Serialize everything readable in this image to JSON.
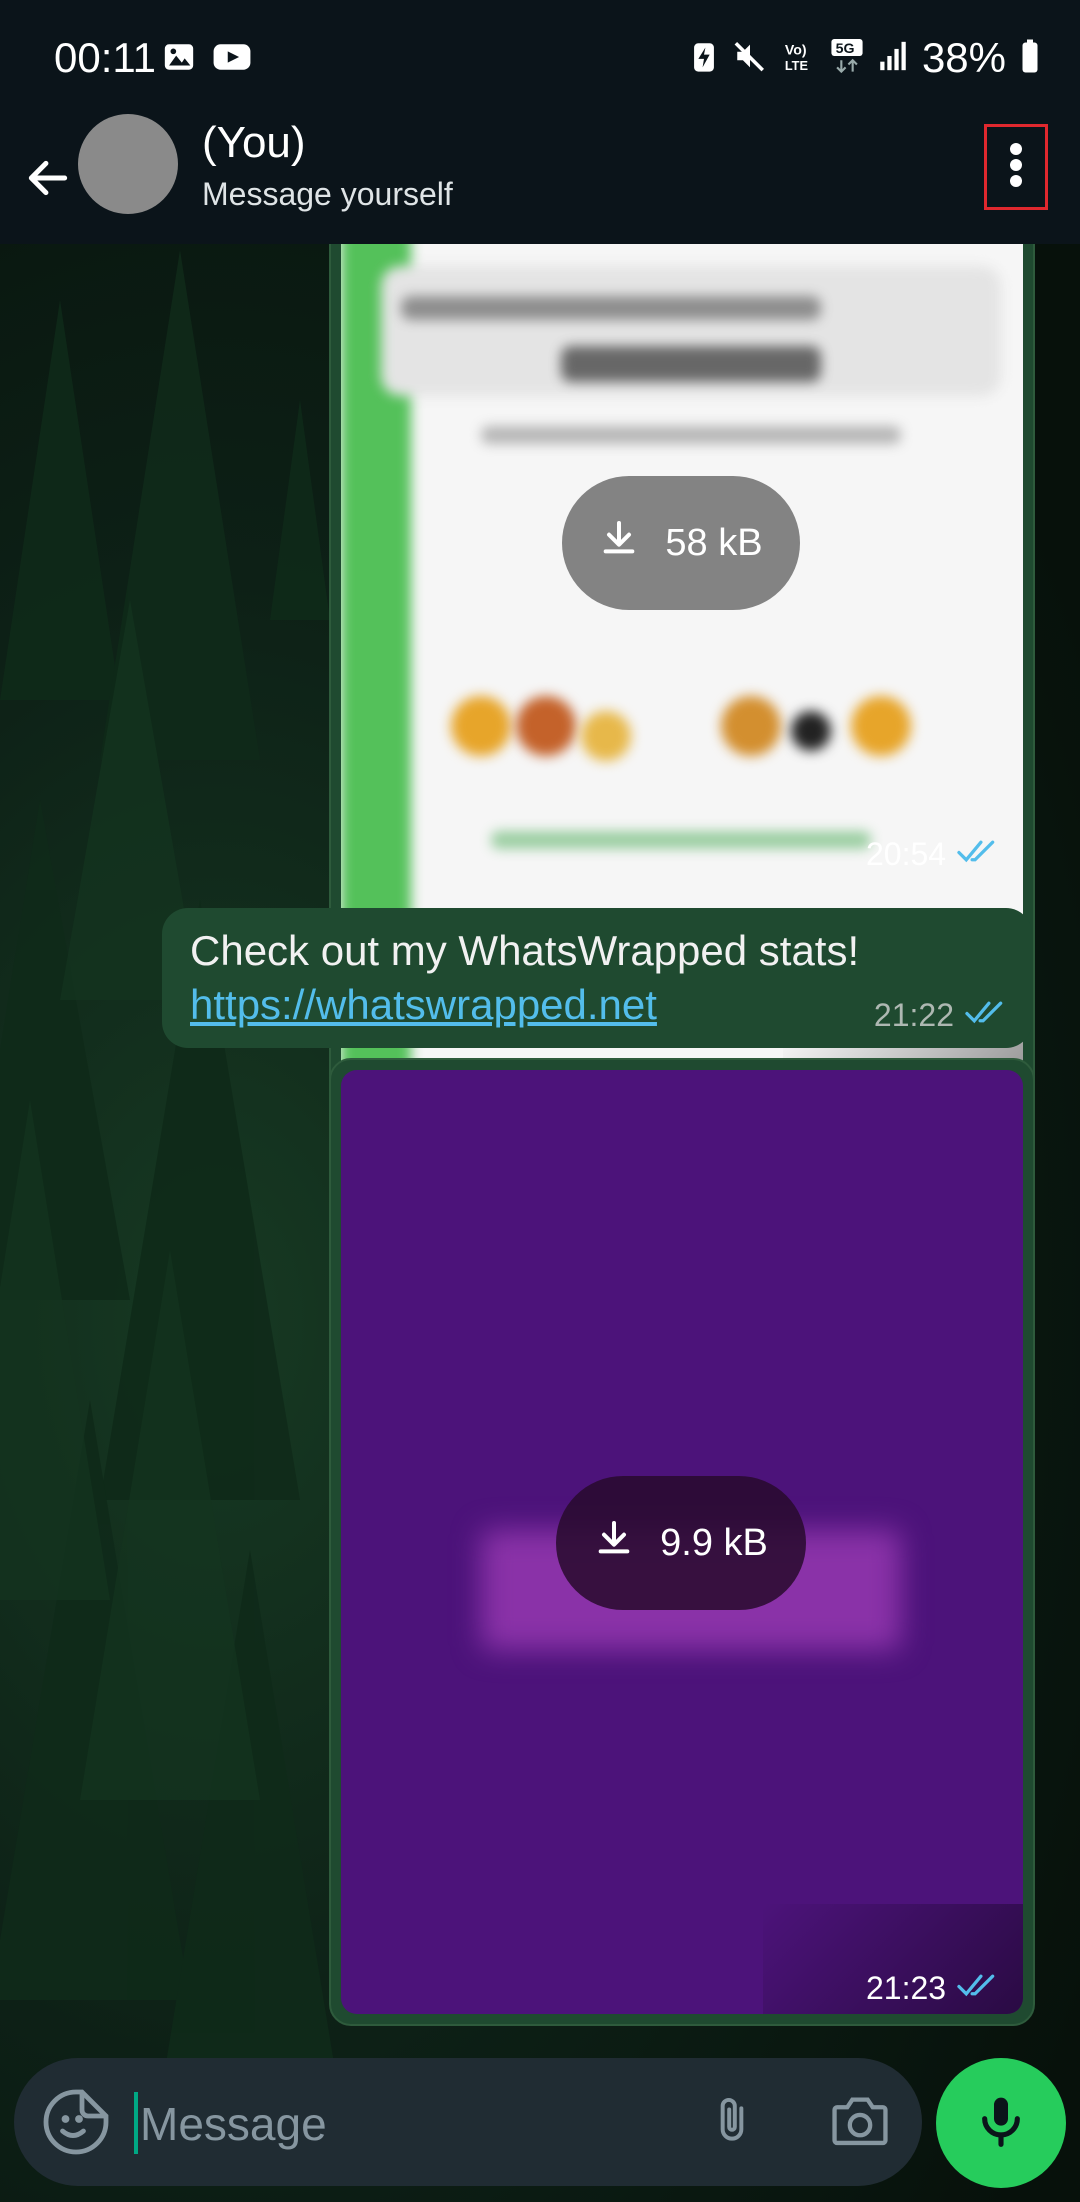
{
  "status_bar": {
    "time": "00:11",
    "battery": "38%",
    "left_icons": [
      "gallery-icon",
      "youtube-icon"
    ],
    "right_icons": [
      "battery-saver-icon",
      "mute-icon",
      "volte-icon",
      "5g-icon",
      "signal-icon",
      "battery-icon"
    ]
  },
  "header": {
    "name": "(You)",
    "subtitle": "Message yourself"
  },
  "messages": [
    {
      "type": "image",
      "size": "58 kB",
      "time": "20:54",
      "status": "read"
    },
    {
      "type": "text",
      "text": "Check out my WhatsWrapped stats!",
      "link": "https://whatswrapped.net",
      "time": "21:22",
      "status": "read"
    },
    {
      "type": "image",
      "size": "9.9 kB",
      "time": "21:23",
      "status": "read"
    }
  ],
  "input": {
    "placeholder": "Message"
  },
  "colors": {
    "accent": "#26cc5c",
    "bubble": "#1f4a30",
    "link": "#53bdeb",
    "highlight": "#e0282e"
  }
}
